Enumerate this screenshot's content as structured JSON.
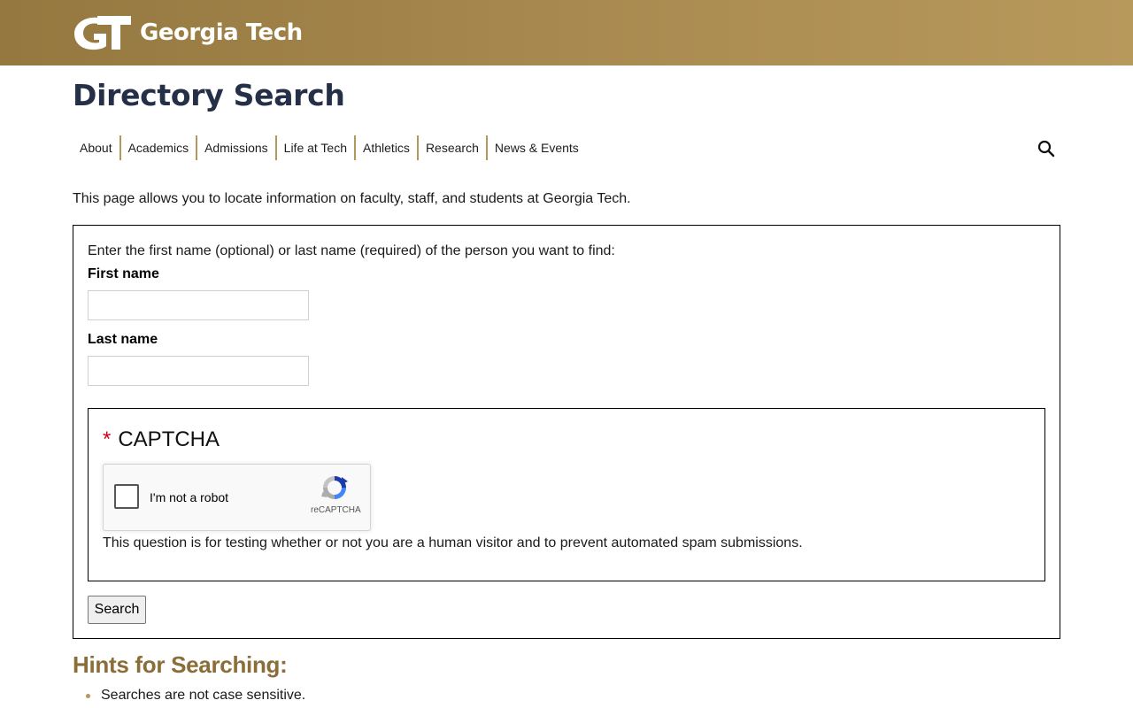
{
  "header": {
    "logo_text": "Georgia Tech",
    "logo_icon": "gt-monogram-icon",
    "background_colors": [
      "#94783f",
      "#b8995c"
    ]
  },
  "page_title": "Directory Search",
  "nav": {
    "items": [
      "About",
      "Academics",
      "Admissions",
      "Life at Tech",
      "Athletics",
      "Research",
      "News & Events"
    ],
    "search_icon": "search-icon",
    "divider_color": "#b3985e"
  },
  "intro": "This page allows you to locate information on faculty, staff, and students at Georgia Tech.",
  "form": {
    "instructions": "Enter the first name (optional) or last name (required) of the person you want to find:",
    "first_name_label": "First name",
    "first_name_value": "",
    "last_name_label": "Last name",
    "last_name_value": "",
    "captcha": {
      "required_marker": "*",
      "title": "CAPTCHA",
      "checkbox_label": "I'm not a robot",
      "brand": "reCAPTCHA",
      "description": "This question is for testing whether or not you are a human visitor and to prevent automated spam submissions."
    },
    "search_button": "Search"
  },
  "hints": {
    "title": "Hints for Searching:",
    "title_color": "#8a6d37",
    "items": [
      "Searches are not case sensitive."
    ]
  },
  "colors": {
    "title_navy": "#262f48",
    "required_red": "#d0021b"
  }
}
